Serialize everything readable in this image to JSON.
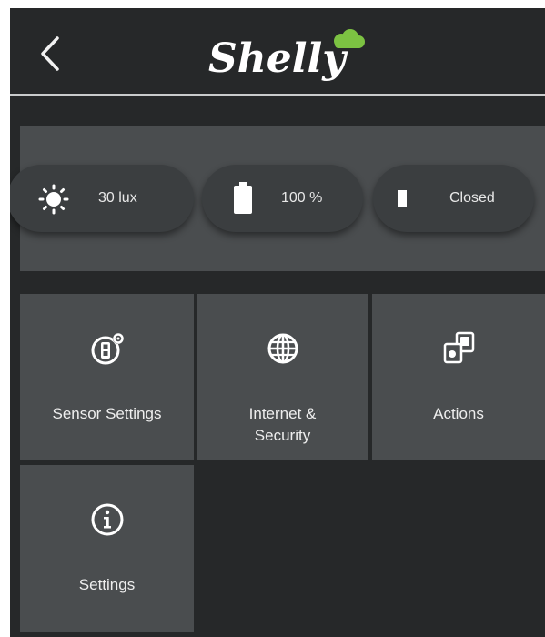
{
  "header": {
    "back_icon": "chevron-left-icon",
    "logo_text": "Shelly",
    "accent_color": "#7cc242"
  },
  "status": {
    "light": {
      "icon": "sun-icon",
      "value": "30 lux"
    },
    "battery": {
      "icon": "battery-icon",
      "value": "100 %"
    },
    "door": {
      "icon": "door-icon",
      "value": "Closed"
    }
  },
  "tiles": {
    "sensor_settings": {
      "icon": "sensor-gear-icon",
      "label": "Sensor Settings"
    },
    "internet_security": {
      "icon": "globe-icon",
      "label": "Internet &\nSecurity"
    },
    "actions": {
      "icon": "actions-icon",
      "label": "Actions"
    },
    "settings": {
      "icon": "info-icon",
      "label": "Settings"
    }
  },
  "colors": {
    "background": "#262829",
    "panel": "#4a4d4f",
    "pill": "#3b3e40",
    "text": "#eeeeee"
  }
}
